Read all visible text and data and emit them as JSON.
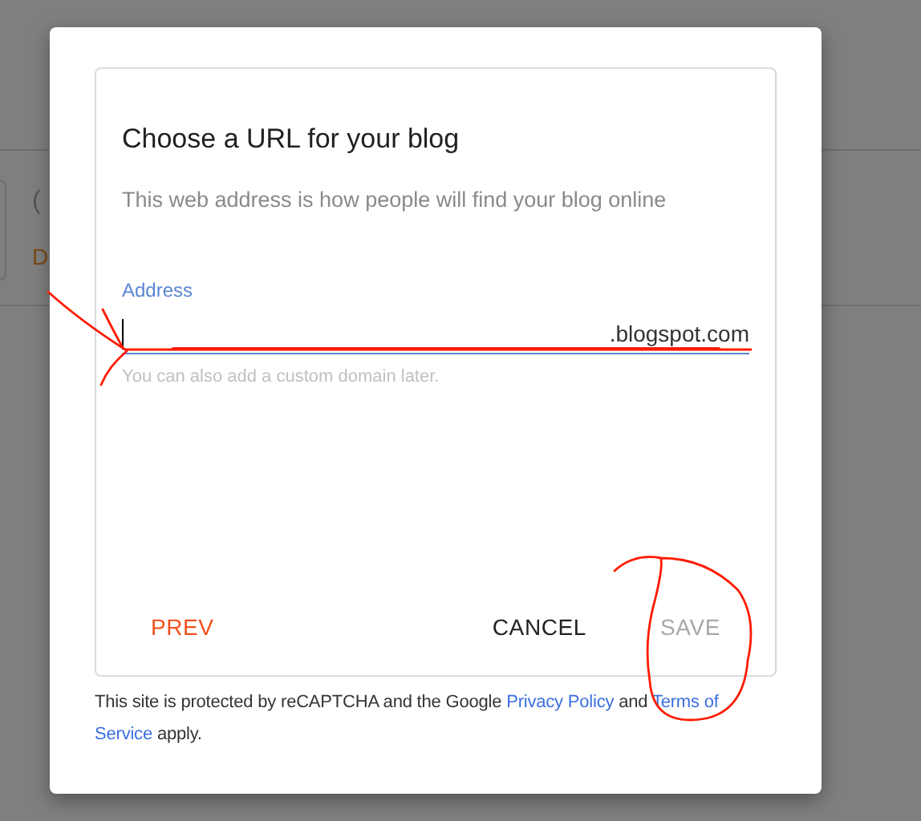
{
  "background_page": {
    "texts": [
      {
        "text": "(",
        "kind": "title"
      },
      {
        "text": "D",
        "kind": "status"
      }
    ]
  },
  "dialog": {
    "title": "Choose a URL for your blog",
    "subtitle": "This web address is how people will find your blog online",
    "address_field": {
      "label": "Address",
      "suffix": ".blogspot.com",
      "helper": "You can also add a custom domain later.",
      "focused": true
    },
    "buttons": [
      {
        "label": "PREV",
        "kind": "prev",
        "disabled": false
      },
      {
        "label": "CANCEL",
        "kind": "cancel",
        "disabled": false
      },
      {
        "label": "SAVE",
        "kind": "save",
        "disabled": true
      }
    ],
    "footer": [
      {
        "kind": "text",
        "text": "This site is protected by reCAPTCHA and the Google"
      },
      {
        "kind": "link",
        "text": "Privacy Policy"
      },
      {
        "kind": "text",
        "text": "and"
      },
      {
        "kind": "link",
        "text": "Terms of"
      },
      {
        "kind": "link",
        "text": "Service"
      },
      {
        "kind": "text",
        "text": "apply."
      }
    ]
  },
  "annotations": {
    "kind": "hand-drawn"
  }
}
